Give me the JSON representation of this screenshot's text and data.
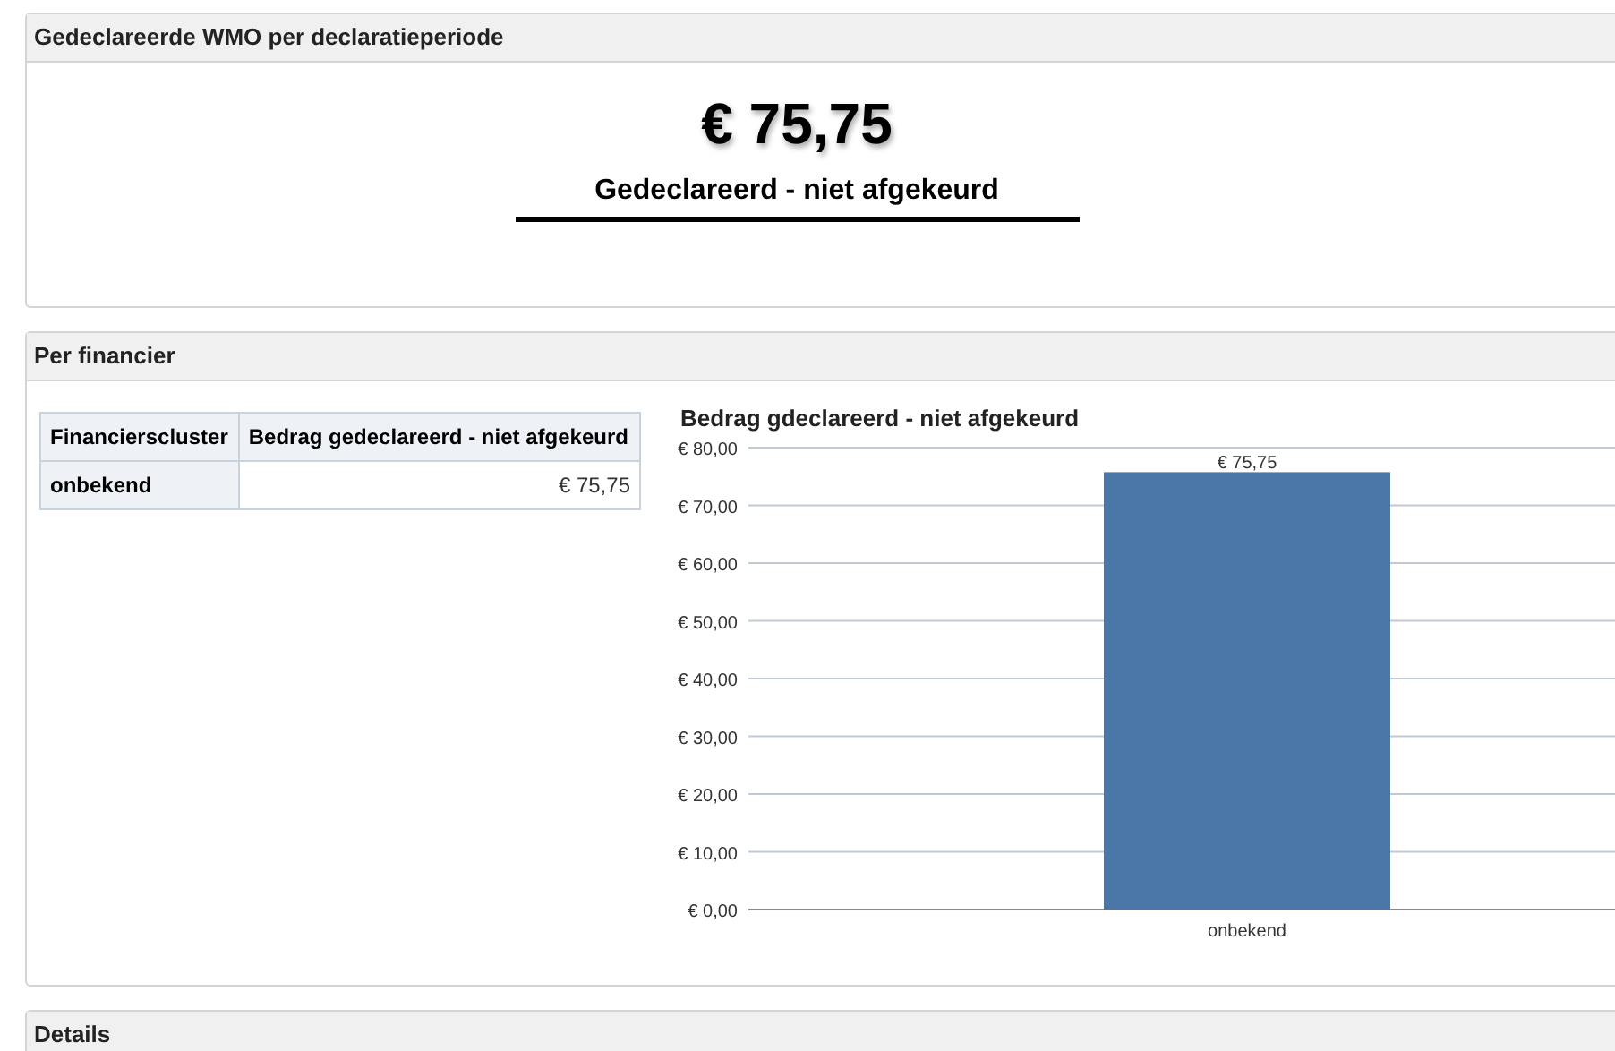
{
  "panels": [
    {
      "title": "Gedeclareerde WMO per declaratieperiode",
      "kpi": {
        "value": "€ 75,75",
        "label": "Gedeclareerd - niet afgekeurd"
      }
    },
    {
      "title": "Per financier",
      "table": {
        "columns": [
          "Financierscluster",
          "Bedrag gedeclareerd - niet afgekeurd"
        ],
        "rows": [
          [
            "onbekend",
            "€ 75,75"
          ]
        ]
      },
      "chart_data": {
        "type": "bar",
        "title": "Bedrag gdeclareerd - niet afgekeurd",
        "categories": [
          "onbekend"
        ],
        "series": [
          {
            "color": "#4a76a8",
            "values": [
              75.75
            ]
          }
        ],
        "ylim": [
          0,
          80
        ],
        "grid": true,
        "yticks": [
          {
            "value": 0,
            "label": "€ 0,00"
          },
          {
            "value": 10,
            "label": "€ 10,00"
          },
          {
            "value": 20,
            "label": "€ 20,00"
          },
          {
            "value": 30,
            "label": "€ 30,00"
          },
          {
            "value": 40,
            "label": "€ 40,00"
          },
          {
            "value": 50,
            "label": "€ 50,00"
          },
          {
            "value": 60,
            "label": "€ 60,00"
          },
          {
            "value": 70,
            "label": "€ 70,00"
          },
          {
            "value": 80,
            "label": "€ 80,00"
          }
        ],
        "value_labels": [
          "€ 75,75"
        ]
      }
    },
    {
      "title": "Details"
    }
  ]
}
